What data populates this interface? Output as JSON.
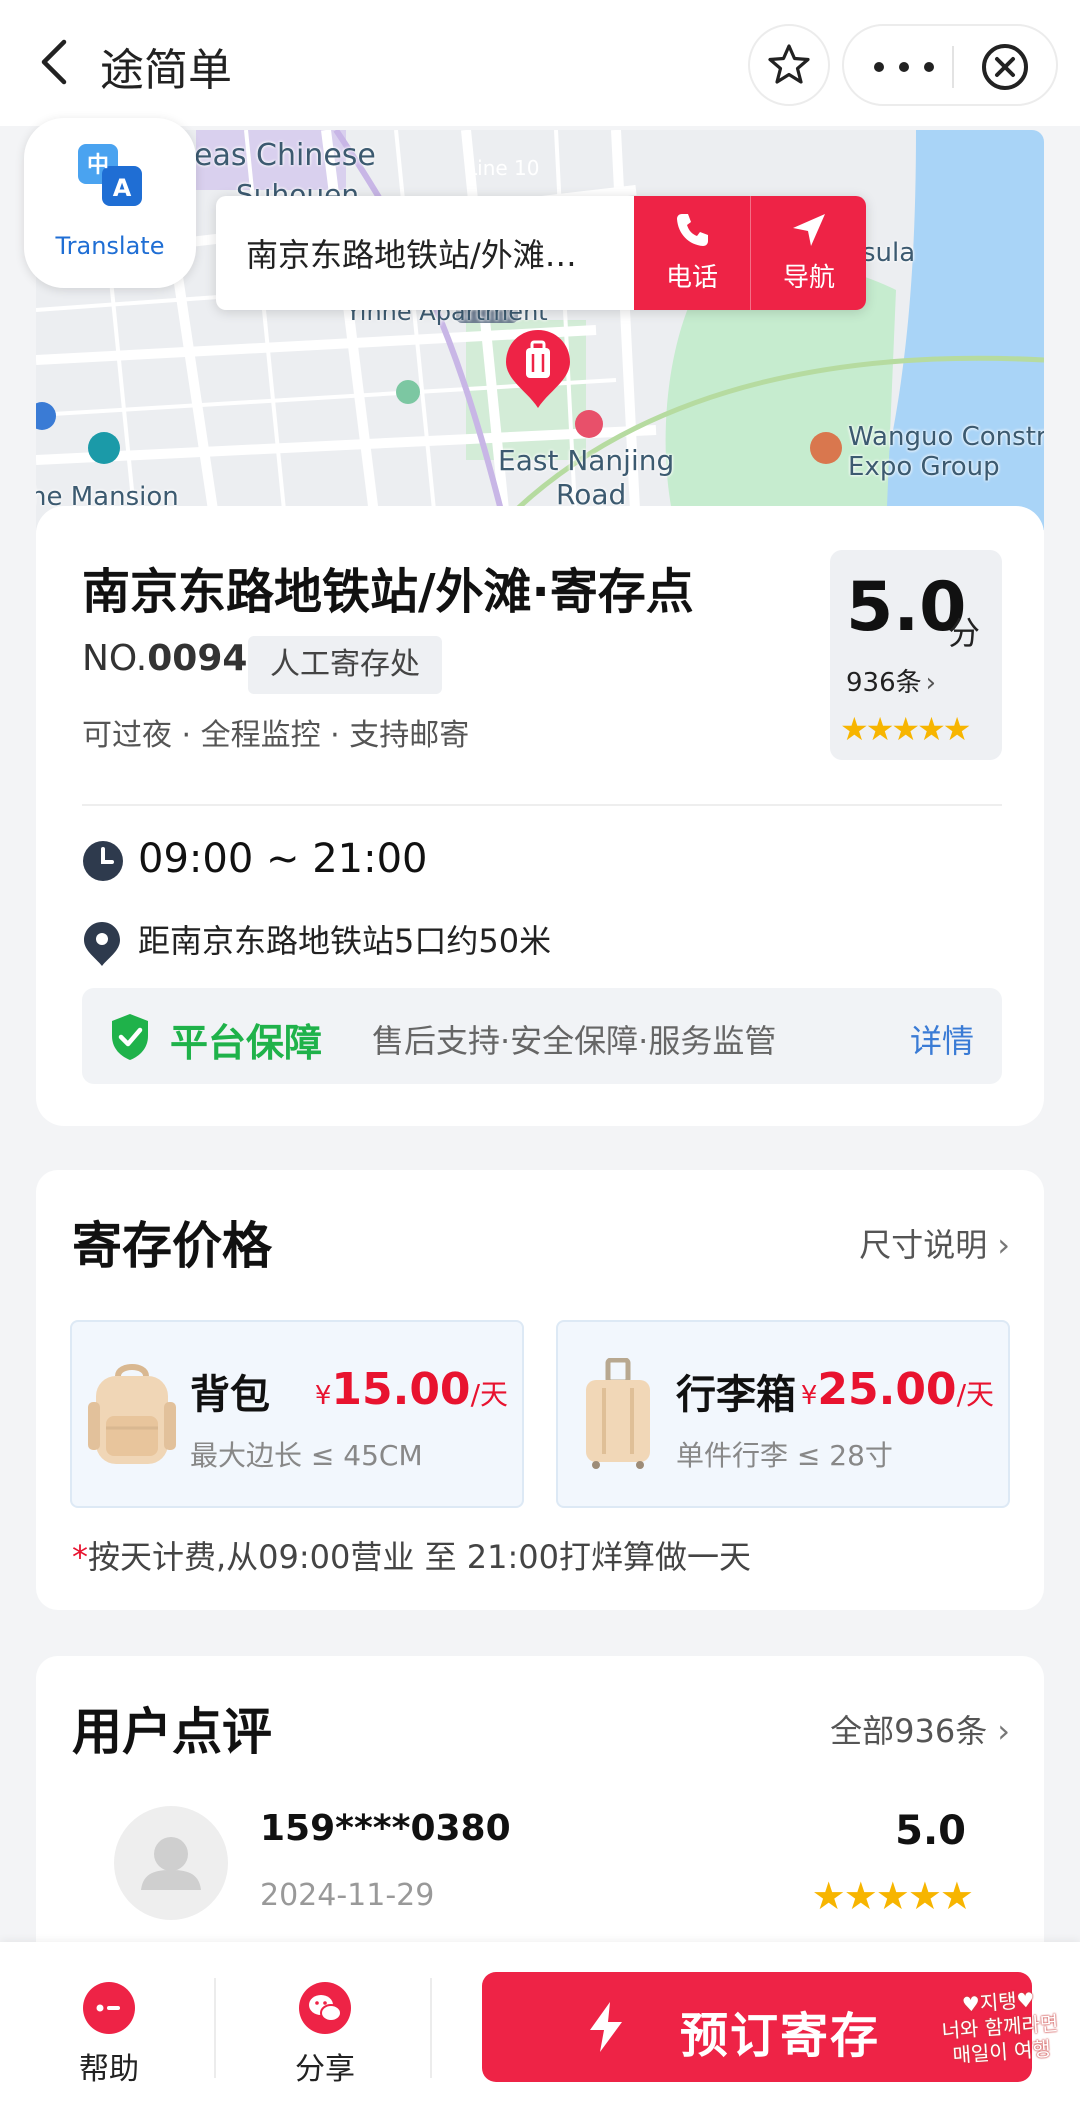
{
  "nav": {
    "title": "途简单",
    "icons": [
      "chevron-left-icon",
      "star-outline-icon",
      "more-dots-icon",
      "close-circle-icon"
    ]
  },
  "map": {
    "labels": {
      "chinese_area": "eas Chinese",
      "chinese_area_2": "Suhouen",
      "line": "Line 10",
      "yinne": "Yinne Apartment",
      "east_nanjing": "East Nanjing",
      "east_nanjing_2": "Road",
      "wanguo": "Wanguo Constr",
      "wanguo_2": "Expo Group",
      "mansion": "he Mansion",
      "sula": "sula"
    },
    "translate_label": "Translate",
    "callout": {
      "address": "南京东路地铁站/外滩…",
      "phone_label": "电话",
      "navigate_label": "导航"
    }
  },
  "store": {
    "title": "南京东路地铁站/外滩·寄存点",
    "no_prefix": "NO.",
    "no_value": "0094",
    "type": "人工寄存处",
    "tags": "可过夜 · 全程监控 · 支持邮寄",
    "rating": "5.0",
    "rating_unit": "分",
    "review_count": "936条",
    "stars": "★★★★★",
    "hours": "09:00 ~ 21:00",
    "distance": "距南京东路地铁站5口约50米",
    "guarantee": {
      "title": "平台保障",
      "desc": "售后支持·安全保障·服务监管",
      "link": "详情"
    }
  },
  "pricing": {
    "title": "寄存价格",
    "size_link": "尺寸说明",
    "items": [
      {
        "name": "背包",
        "currency": "¥",
        "amount": "15.00",
        "unit": "/天",
        "desc": "最大边长 ≤ 45CM"
      },
      {
        "name": "行李箱",
        "currency": "¥",
        "amount": "25.00",
        "unit": "/天",
        "desc": "单件行李 ≤ 28寸"
      }
    ],
    "note_star": "*",
    "note": "按天计费,从09:00营业 至 21:00打烊算做一天"
  },
  "reviews": {
    "title": "用户点评",
    "all_link": "全部936条",
    "items": [
      {
        "user": "159****0380",
        "date": "2024-11-29",
        "score": "5.0",
        "stars": "★★★★★"
      }
    ]
  },
  "bottom": {
    "help_label": "帮助",
    "share_label": "分享",
    "book_label": "预订寄存",
    "watermark": [
      "♥지탱♥",
      "너와 함께라면",
      "매일이 여행"
    ]
  },
  "colors": {
    "accent": "#ee2346",
    "price": "#e8132f",
    "guarantee_green": "#1fb24a",
    "link_blue": "#3a7bd5",
    "star_yellow": "#f7b500"
  }
}
